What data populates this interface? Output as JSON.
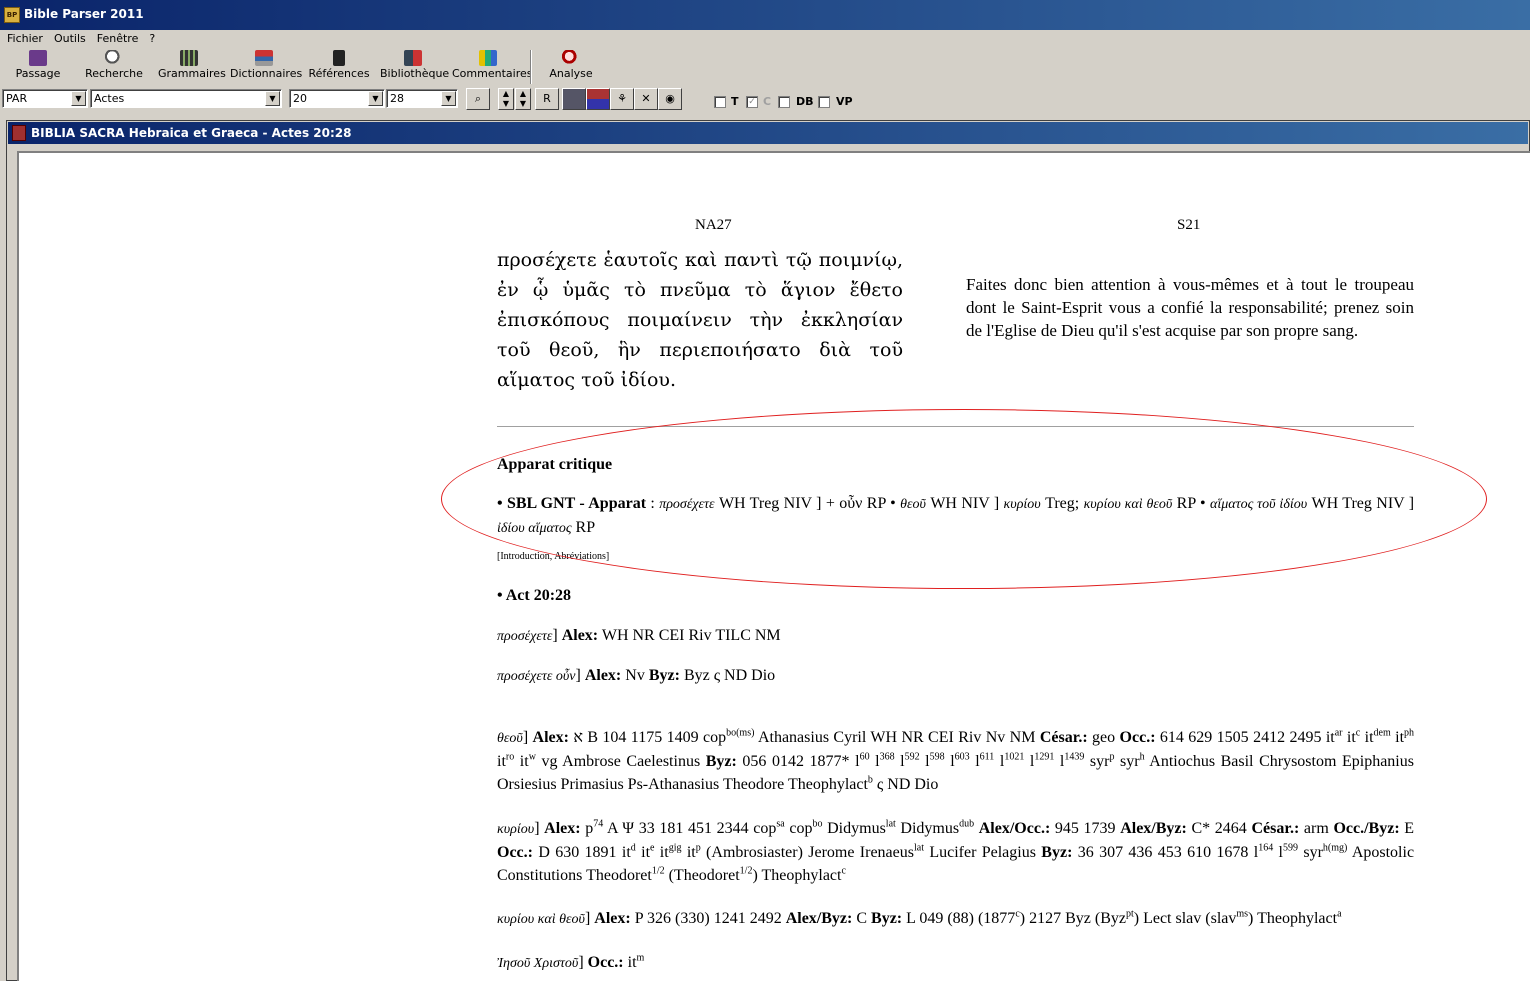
{
  "window": {
    "title": "Bible Parser 2011",
    "icon": "app-icon"
  },
  "menu": [
    "Fichier",
    "Outils",
    "Fenêtre",
    "?"
  ],
  "toolbar": {
    "buttons": [
      {
        "label": "Passage",
        "icon": "book-icon"
      },
      {
        "label": "Recherche",
        "icon": "magnifier-icon"
      },
      {
        "label": "Grammaires",
        "icon": "books-icon"
      },
      {
        "label": "Dictionnaires",
        "icon": "dictionary-icon"
      },
      {
        "label": "Références",
        "icon": "references-icon"
      },
      {
        "label": "Bibliothèque",
        "icon": "library-icon"
      },
      {
        "label": "Commentaires",
        "icon": "comments-icon"
      },
      {
        "label": "Analyse",
        "icon": "analyse-icon"
      }
    ]
  },
  "combos": {
    "version": "PAR",
    "book": "Actes",
    "chapter": "20",
    "verse": "28"
  },
  "checks": {
    "t_label": "T",
    "c_label": "C",
    "db_label": "DB",
    "vp_label": "VP",
    "r_button": "R"
  },
  "doc": {
    "title": "BIBLIA SACRA Hebraica et Graeca - Actes 20:28",
    "left_header": "NA27",
    "right_header": "S21",
    "greek_text": "προσέχετε ἑαυτοῖς καὶ παντὶ τῷ ποιμνίῳ, ἐν ᾧ ὑμᾶς τὸ πνεῦμα τὸ ἅγιον ἔθετο ἐπισκόπους ποιμαίνειν τὴν ἐκκλησίαν τοῦ θεοῦ, ἣν περιεποιήσατο διὰ τοῦ αἵματος τοῦ ἰδίου.",
    "french_text": "Faites donc bien attention à vous-mêmes et à tout le troupeau dont le Saint-Esprit vous a confié la responsabilité; prenez soin de l'Eglise de Dieu qu'il s'est acquise par son propre sang.",
    "apparatus_title": "Apparat critique",
    "sbl_label": "• SBL GNT - Apparat",
    "sbl_text_1": "προσέχετε",
    "sbl_text_2": "WH Treg NIV ] + οὖν RP •",
    "sbl_text_3": "θεοῦ",
    "sbl_text_4": "WH NIV ]",
    "sbl_text_5": "κυρίου",
    "sbl_text_6": "Treg;",
    "sbl_text_7": "κυρίου καὶ θεοῦ",
    "sbl_text_8": "RP •",
    "sbl_text_9": "αἵματος τοῦ ἰδίου",
    "sbl_text_10": "WH Treg NIV ]",
    "sbl_text_11": "ἰδίου αἵματος",
    "sbl_text_12": "RP",
    "intro_link": "[Introduction, Abréviations]",
    "act_ref": "• Act 20:28",
    "entries": {
      "e1_lemma": "προσέχετε",
      "e1_rest": "Alex:",
      "e1_wit": "WH NR CEI Riv TILC NM",
      "e2_lemma": "προσέχετε οὖν",
      "e2_alex": "Alex:",
      "e2_nv": "Nv",
      "e2_byz": "Byz:",
      "e2_wit": "Byz ς ND Dio"
    }
  }
}
